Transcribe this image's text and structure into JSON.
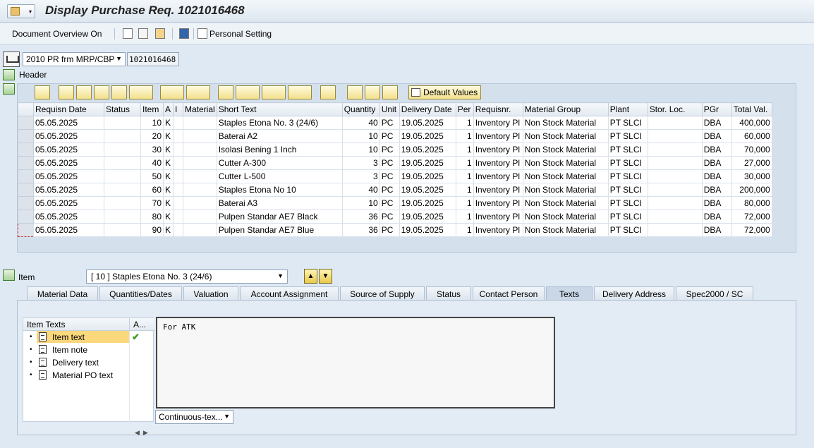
{
  "window": {
    "title": "Display Purchase Req. 1021016468"
  },
  "toolbar": {
    "document_overview": "Document Overview On",
    "personal_setting": "Personal Setting"
  },
  "doc": {
    "type": "2010 PR frm MRP/CBP",
    "number": "1021016468"
  },
  "header": {
    "label": "Header"
  },
  "grid": {
    "default_values": "Default Values",
    "columns": [
      "Requisn Date",
      "Status",
      "Item",
      "A",
      "I",
      "Material",
      "Short Text",
      "Quantity",
      "Unit",
      "Delivery Date",
      "Per",
      "Requisnr.",
      "Material Group",
      "Plant",
      "Stor. Loc.",
      "PGr",
      "Total Val."
    ],
    "rows": [
      [
        "05.05.2025",
        "",
        "10",
        "K",
        "",
        "",
        "Staples Etona No. 3 (24/6)",
        "40",
        "PC",
        "19.05.2025",
        "1",
        "Inventory Pl",
        "Non Stock Material",
        "PT SLCI",
        "",
        "DBA",
        "400,000"
      ],
      [
        "05.05.2025",
        "",
        "20",
        "K",
        "",
        "",
        "Baterai A2",
        "10",
        "PC",
        "19.05.2025",
        "1",
        "Inventory Pl",
        "Non Stock Material",
        "PT SLCI",
        "",
        "DBA",
        "60,000"
      ],
      [
        "05.05.2025",
        "",
        "30",
        "K",
        "",
        "",
        "Isolasi Bening 1 Inch",
        "10",
        "PC",
        "19.05.2025",
        "1",
        "Inventory Pl",
        "Non Stock Material",
        "PT SLCI",
        "",
        "DBA",
        "70,000"
      ],
      [
        "05.05.2025",
        "",
        "40",
        "K",
        "",
        "",
        "Cutter A-300",
        "3",
        "PC",
        "19.05.2025",
        "1",
        "Inventory Pl",
        "Non Stock Material",
        "PT SLCI",
        "",
        "DBA",
        "27,000"
      ],
      [
        "05.05.2025",
        "",
        "50",
        "K",
        "",
        "",
        "Cutter L-500",
        "3",
        "PC",
        "19.05.2025",
        "1",
        "Inventory Pl",
        "Non Stock Material",
        "PT SLCI",
        "",
        "DBA",
        "30,000"
      ],
      [
        "05.05.2025",
        "",
        "60",
        "K",
        "",
        "",
        "Staples Etona No 10",
        "40",
        "PC",
        "19.05.2025",
        "1",
        "Inventory Pl",
        "Non Stock Material",
        "PT SLCI",
        "",
        "DBA",
        "200,000"
      ],
      [
        "05.05.2025",
        "",
        "70",
        "K",
        "",
        "",
        "Baterai A3",
        "10",
        "PC",
        "19.05.2025",
        "1",
        "Inventory Pl",
        "Non Stock Material",
        "PT SLCI",
        "",
        "DBA",
        "80,000"
      ],
      [
        "05.05.2025",
        "",
        "80",
        "K",
        "",
        "",
        "Pulpen Standar AE7 Black",
        "36",
        "PC",
        "19.05.2025",
        "1",
        "Inventory Pl",
        "Non Stock Material",
        "PT SLCI",
        "",
        "DBA",
        "72,000"
      ],
      [
        "05.05.2025",
        "",
        "90",
        "K",
        "",
        "",
        "Pulpen Standar AE7 Blue",
        "36",
        "PC",
        "19.05.2025",
        "1",
        "Inventory Pl",
        "Non Stock Material",
        "PT SLCI",
        "",
        "DBA",
        "72,000"
      ]
    ]
  },
  "item": {
    "label": "Item",
    "selected": "[ 10 ] Staples Etona No. 3 (24/6)",
    "tabs": [
      "Material Data",
      "Quantities/Dates",
      "Valuation",
      "Account Assignment",
      "Source of Supply",
      "Status",
      "Contact Person",
      "Texts",
      "Delivery Address",
      "Spec2000 / SC"
    ],
    "active_tab": "Texts"
  },
  "texts": {
    "tree_header": "Item Texts",
    "tree_header_col2": "A...",
    "items": [
      "Item text",
      "Item note",
      "Delivery text",
      "Material PO text"
    ],
    "editor_content": "For ATK",
    "format": "Continuous-tex..."
  }
}
